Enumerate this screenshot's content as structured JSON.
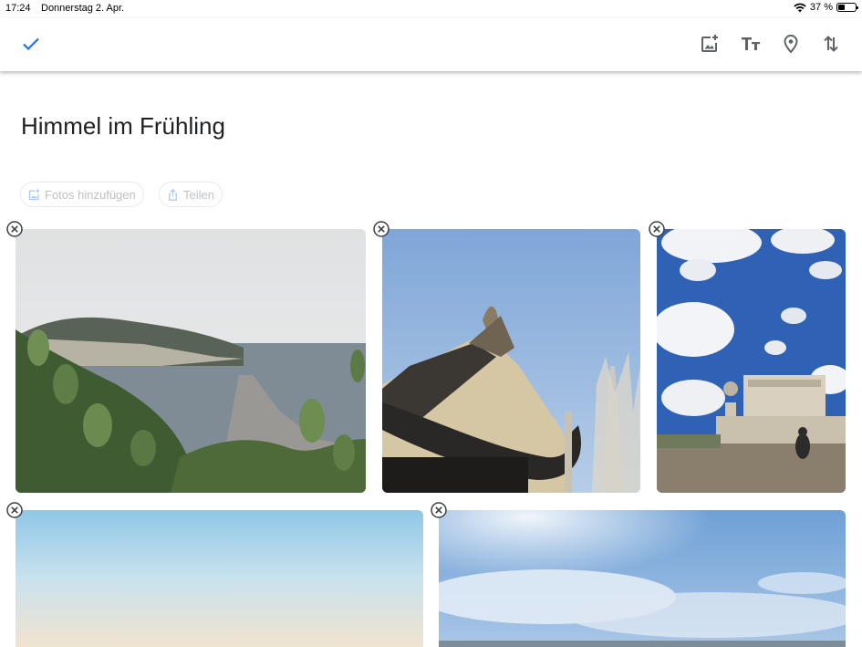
{
  "status_bar": {
    "time": "17:24",
    "date": "Donnerstag 2. Apr.",
    "battery_label": "37 %",
    "battery_level": 0.37
  },
  "toolbar": {
    "done_icon": "check-icon",
    "tools": [
      "add-photo-icon",
      "text-format-icon",
      "location-pin-icon",
      "reorder-icon"
    ]
  },
  "album": {
    "title": "Himmel im Frühling"
  },
  "actions": {
    "add_photos_label": "Fotos hinzufügen",
    "share_label": "Teilen"
  },
  "photos": [
    {
      "subject": "coastline-with-cacti"
    },
    {
      "subject": "chinese-temple-roof"
    },
    {
      "subject": "palace-under-clouds"
    },
    {
      "subject": "gradient-sky"
    },
    {
      "subject": "sky-with-sun"
    }
  ],
  "colors": {
    "accent": "#1a73e8",
    "chip_text": "#bdc1c6",
    "icon": "#5f6368"
  }
}
